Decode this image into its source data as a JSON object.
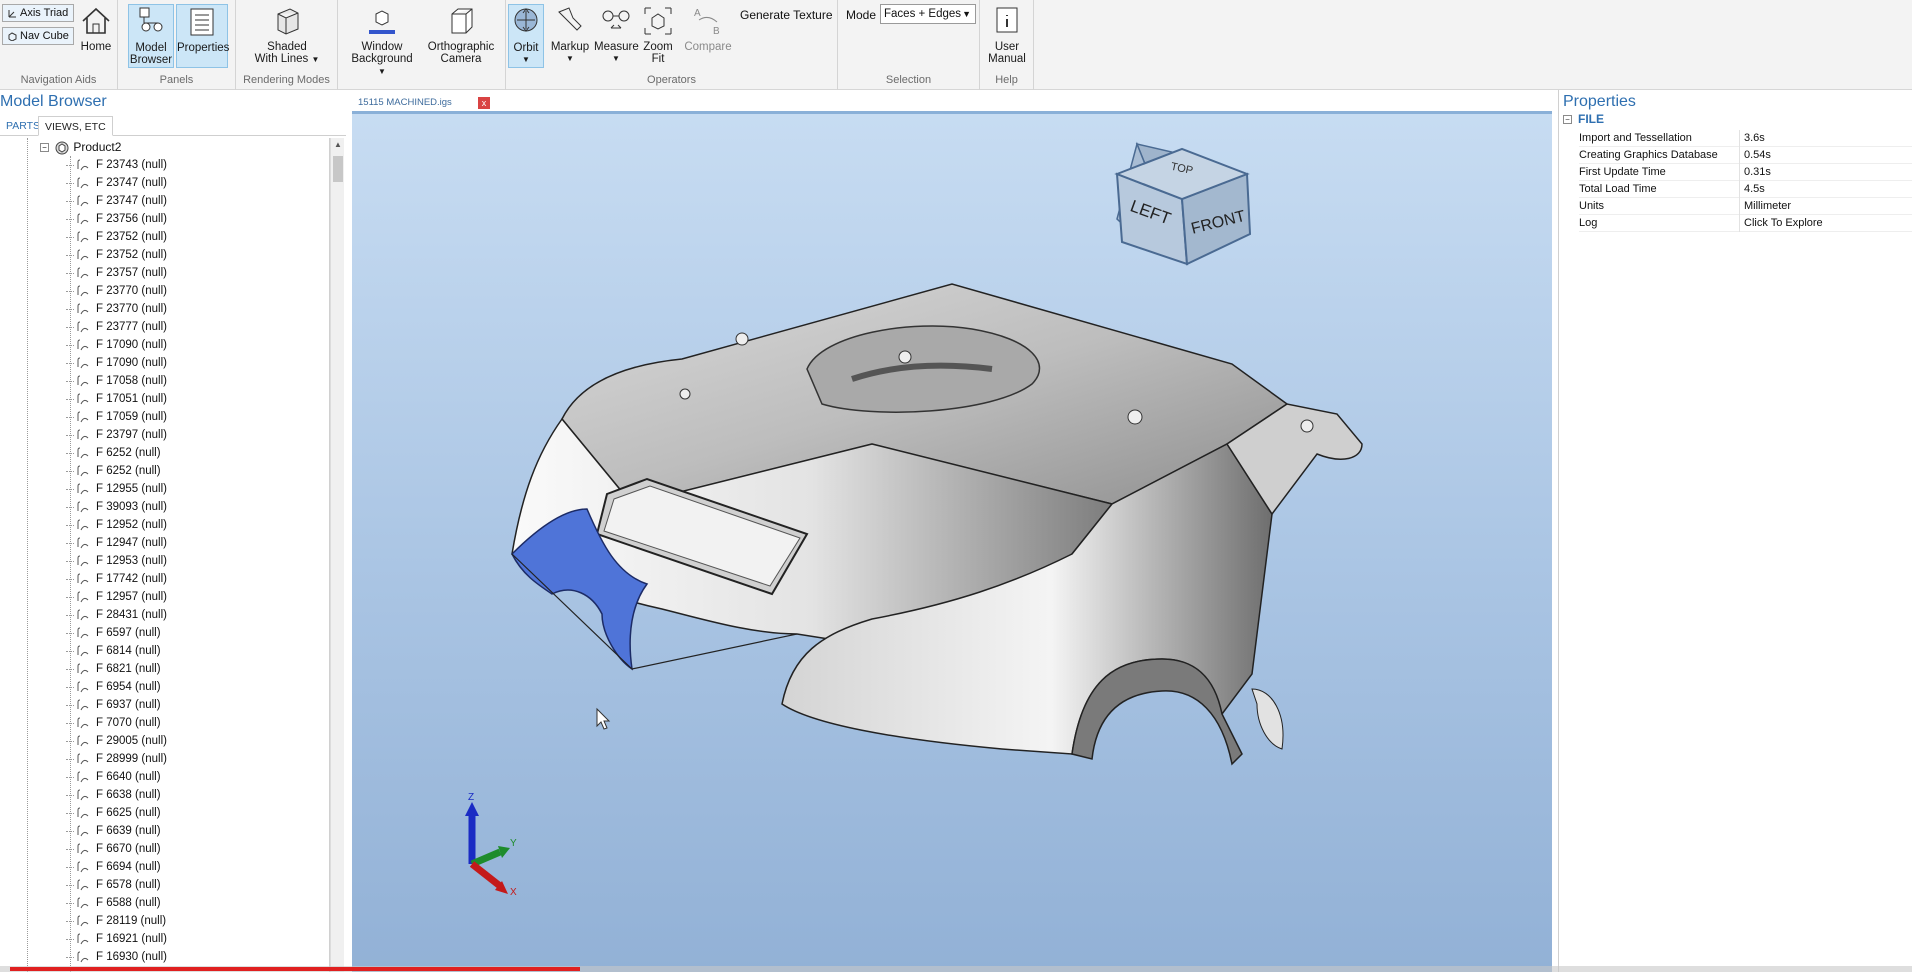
{
  "ribbon": {
    "navigation_aids": {
      "axis_triad": "Axis Triad",
      "nav_cube": "Nav Cube",
      "home": "Home",
      "label": "Navigation Aids"
    },
    "panels": {
      "model_browser": [
        "Model",
        "Browser"
      ],
      "properties": "Properties",
      "label": "Panels"
    },
    "rendering": {
      "shaded": [
        "Shaded",
        "With Lines"
      ],
      "window_bg": [
        "Window",
        "Background"
      ],
      "ortho": [
        "Orthographic",
        "Camera"
      ],
      "label": "Rendering Modes"
    },
    "operators": {
      "orbit": "Orbit",
      "markup": "Markup",
      "measure": "Measure",
      "zoom_fit": [
        "Zoom",
        "Fit"
      ],
      "compare": "Compare",
      "generate_texture": "Generate Texture",
      "label": "Operators"
    },
    "selection": {
      "mode_label": "Mode",
      "mode_value": "Faces + Edges",
      "label": "Selection"
    },
    "help": {
      "user_manual": [
        "User",
        "Manual"
      ],
      "label": "Help"
    }
  },
  "model_browser": {
    "title": "Model Browser",
    "tabs": [
      "PARTS",
      "VIEWS, ETC"
    ],
    "root": "Product2",
    "items": [
      "F 23743 (null)",
      "F 23747 (null)",
      "F 23747 (null)",
      "F 23756 (null)",
      "F 23752 (null)",
      "F 23752 (null)",
      "F 23757 (null)",
      "F 23770 (null)",
      "F 23770 (null)",
      "F 23777 (null)",
      "F 17090 (null)",
      "F 17090 (null)",
      "F 17058 (null)",
      "F 17051 (null)",
      "F 17059 (null)",
      "F 23797 (null)",
      "F 6252 (null)",
      "F 6252 (null)",
      "F 12955 (null)",
      "F 39093 (null)",
      "F 12952 (null)",
      "F 12947 (null)",
      "F 12953 (null)",
      "F 17742 (null)",
      "F 12957 (null)",
      "F 28431 (null)",
      "F 6597 (null)",
      "F 6814 (null)",
      "F 6821 (null)",
      "F 6954 (null)",
      "F 6937 (null)",
      "F 7070 (null)",
      "F 29005 (null)",
      "F 28999 (null)",
      "F 6640 (null)",
      "F 6638 (null)",
      "F 6625 (null)",
      "F 6639 (null)",
      "F 6670 (null)",
      "F 6694 (null)",
      "F 6578 (null)",
      "F 6588 (null)",
      "F 28119 (null)",
      "F 16921 (null)",
      "F 16930 (null)"
    ]
  },
  "viewer": {
    "doc_tab": "15115 MACHINED.igs",
    "nav_cube": {
      "top": "TOP",
      "left": "LEFT",
      "front": "FRONT"
    },
    "triad": {
      "z": "Z",
      "y": "Y",
      "x": "X"
    }
  },
  "properties": {
    "title": "Properties",
    "section": "FILE",
    "rows": [
      {
        "key": "Import and Tessellation",
        "value": "3.6s"
      },
      {
        "key": "Creating Graphics Database",
        "value": "0.54s"
      },
      {
        "key": "First Update Time",
        "value": "0.31s"
      },
      {
        "key": "Total Load Time",
        "value": "4.5s"
      },
      {
        "key": "Units",
        "value": "Millimeter"
      },
      {
        "key": "Log",
        "value": "Click To Explore"
      }
    ]
  },
  "video_progress": 0.3
}
